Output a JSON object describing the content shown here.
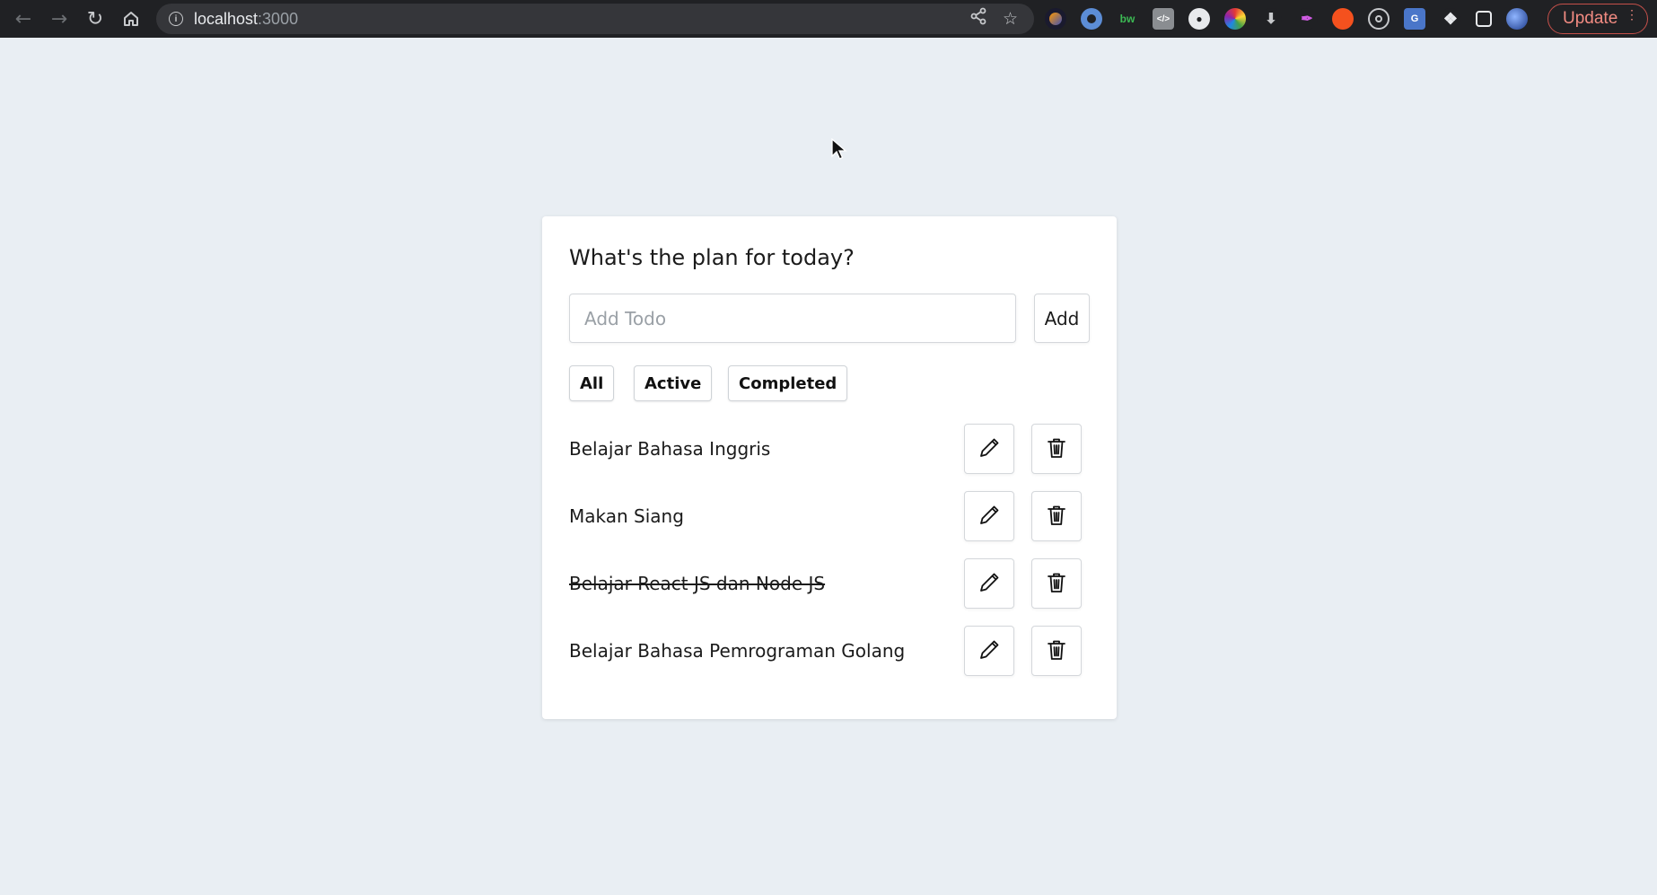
{
  "browser": {
    "url_host": "localhost",
    "url_port": ":3000",
    "update_label": "Update"
  },
  "app": {
    "title": "What's the plan for today?",
    "input_placeholder": "Add Todo",
    "input_value": "",
    "add_label": "Add",
    "filters": [
      {
        "label": "All"
      },
      {
        "label": "Active"
      },
      {
        "label": "Completed"
      }
    ],
    "todos": [
      {
        "text": "Belajar Bahasa Inggris",
        "completed": false
      },
      {
        "text": "Makan Siang",
        "completed": false
      },
      {
        "text": "Belajar React JS dan Node JS",
        "completed": true
      },
      {
        "text": "Belajar Bahasa Pemrograman Golang",
        "completed": false
      }
    ]
  },
  "icons": {
    "edit": "pencil-icon",
    "delete": "trash-icon"
  },
  "colors": {
    "page_background": "#e9eef3",
    "card_background": "#ffffff",
    "browser_chrome": "#202124",
    "update_accent": "#f28b82"
  }
}
